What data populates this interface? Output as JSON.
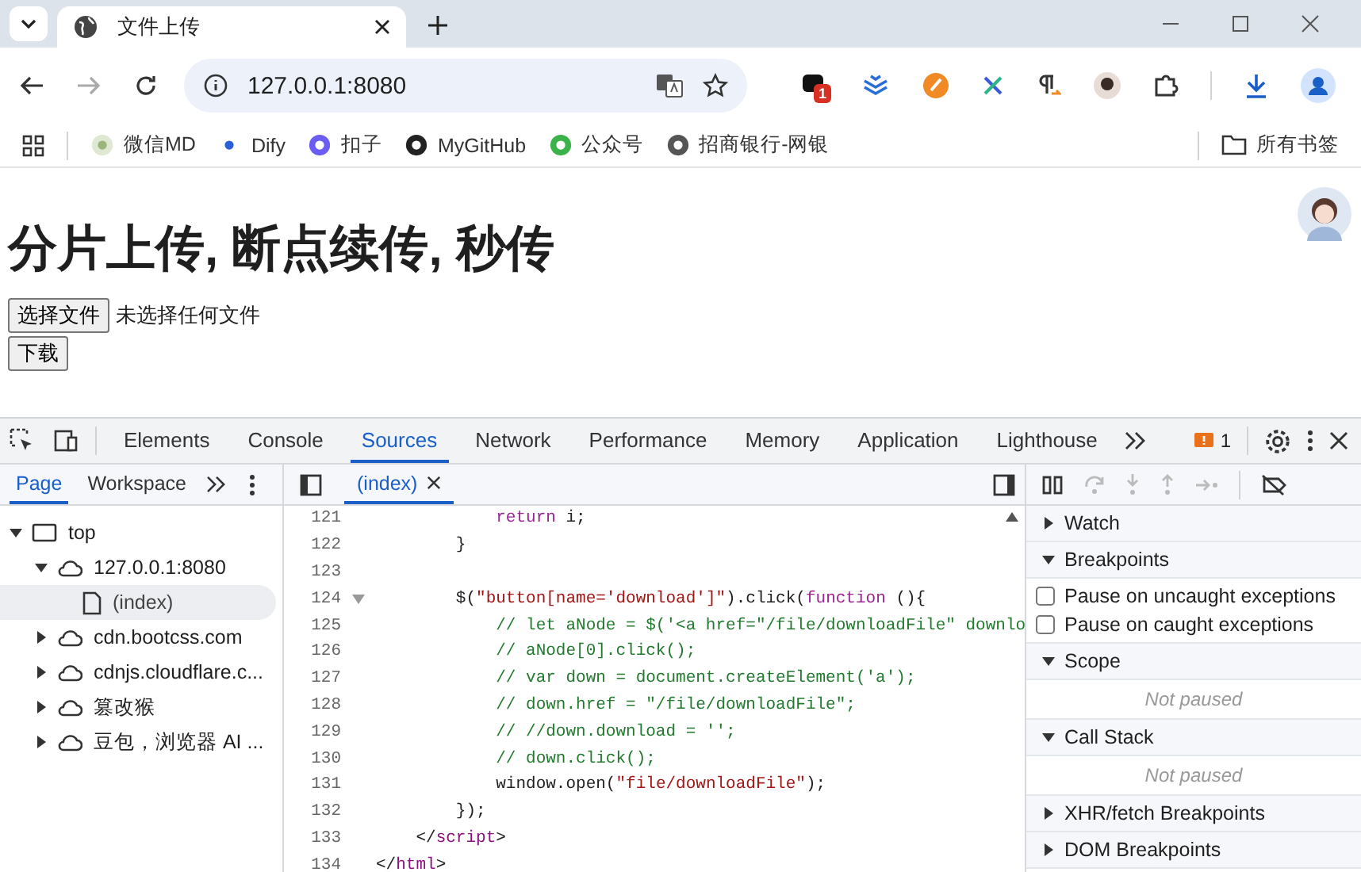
{
  "browser": {
    "tabs": [
      {
        "title": "文件上传",
        "selected": true
      }
    ],
    "address": "127.0.0.1:8080",
    "extension_badge": "1",
    "bookmarks": [
      {
        "label": "微信MD"
      },
      {
        "label": "Dify"
      },
      {
        "label": "扣子"
      },
      {
        "label": "MyGitHub"
      },
      {
        "label": "公众号"
      },
      {
        "label": "招商银行-网银"
      }
    ],
    "all_bookmarks": "所有书签"
  },
  "page": {
    "heading": "分片上传, 断点续传, 秒传",
    "file_button": "选择文件",
    "file_status": "未选择任何文件",
    "download_button": "下载"
  },
  "devtools": {
    "tabs": [
      {
        "label": "Elements",
        "selected": false
      },
      {
        "label": "Console",
        "selected": false
      },
      {
        "label": "Sources",
        "selected": true
      },
      {
        "label": "Network",
        "selected": false
      },
      {
        "label": "Performance",
        "selected": false
      },
      {
        "label": "Memory",
        "selected": false
      },
      {
        "label": "Application",
        "selected": false
      },
      {
        "label": "Lighthouse",
        "selected": false
      }
    ],
    "issues_count": "1",
    "nav_tabs": [
      {
        "label": "Page",
        "selected": true
      },
      {
        "label": "Workspace",
        "selected": false
      }
    ],
    "editor_tab": "(index)",
    "tree": [
      {
        "label": "top",
        "kind": "frame",
        "expanded": true,
        "selected": false,
        "children": [
          {
            "label": "127.0.0.1:8080",
            "kind": "domain",
            "expanded": true,
            "selected": false,
            "children": [
              {
                "label": "(index)",
                "kind": "file",
                "selected": true
              }
            ]
          },
          {
            "label": "cdn.bootcss.com",
            "kind": "domain",
            "expanded": false,
            "selected": false
          },
          {
            "label": "cdnjs.cloudflare.c...",
            "kind": "domain",
            "expanded": false,
            "selected": false
          },
          {
            "label": "篡改猴",
            "kind": "domain",
            "expanded": false,
            "selected": false
          },
          {
            "label": "豆包，浏览器 AI ...",
            "kind": "domain",
            "expanded": false,
            "selected": false
          }
        ]
      }
    ],
    "code": [
      {
        "number": "121",
        "foldable": false,
        "tokens": [
          {
            "kind": "keyword",
            "text": "            return"
          },
          {
            "kind": "plain",
            "text": " i;"
          }
        ]
      },
      {
        "number": "122",
        "foldable": false,
        "tokens": [
          {
            "kind": "plain",
            "text": "        }"
          }
        ]
      },
      {
        "number": "123",
        "foldable": false
      },
      {
        "number": "124",
        "foldable": true,
        "tokens": [
          {
            "kind": "plain",
            "text": "        $("
          },
          {
            "kind": "string",
            "text": "\"button[name='download']\""
          },
          {
            "kind": "plain",
            "text": ").click("
          },
          {
            "kind": "keyword",
            "text": "function"
          },
          {
            "kind": "plain",
            "text": " (){"
          }
        ]
      },
      {
        "number": "125",
        "foldable": false,
        "tokens": [
          {
            "kind": "comment",
            "text": "            // let aNode = $('<a href=\"/file/downloadFile\" downlo"
          }
        ]
      },
      {
        "number": "126",
        "foldable": false,
        "tokens": [
          {
            "kind": "comment",
            "text": "            // aNode[0].click();"
          }
        ]
      },
      {
        "number": "127",
        "foldable": false,
        "tokens": [
          {
            "kind": "comment",
            "text": "            // var down = document.createElement('a');"
          }
        ]
      },
      {
        "number": "128",
        "foldable": false,
        "tokens": [
          {
            "kind": "comment",
            "text": "            // down.href = \"/file/downloadFile\";"
          }
        ]
      },
      {
        "number": "129",
        "foldable": false,
        "tokens": [
          {
            "kind": "comment",
            "text": "            // //down.download = '';"
          }
        ]
      },
      {
        "number": "130",
        "foldable": false,
        "tokens": [
          {
            "kind": "comment",
            "text": "            // down.click();"
          }
        ]
      },
      {
        "number": "131",
        "foldable": false,
        "tokens": [
          {
            "kind": "plain",
            "text": "            window.open("
          },
          {
            "kind": "string",
            "text": "\"file/downloadFile\""
          },
          {
            "kind": "plain",
            "text": ");"
          }
        ]
      },
      {
        "number": "132",
        "foldable": false,
        "tokens": [
          {
            "kind": "plain",
            "text": "        });"
          }
        ]
      },
      {
        "number": "133",
        "foldable": false,
        "tokens": [
          {
            "kind": "plain",
            "text": "    </"
          },
          {
            "kind": "tag",
            "text": "script"
          },
          {
            "kind": "plain",
            "text": ">"
          }
        ]
      },
      {
        "number": "134",
        "foldable": false,
        "tokens": [
          {
            "kind": "plain",
            "text": "</"
          },
          {
            "kind": "tag",
            "text": "html"
          },
          {
            "kind": "plain",
            "text": ">"
          }
        ]
      }
    ],
    "sections": [
      {
        "title": "Watch",
        "expanded": false
      },
      {
        "title": "Breakpoints",
        "expanded": true,
        "checkboxes": [
          {
            "label": "Pause on uncaught exceptions",
            "checked": false
          },
          {
            "label": "Pause on caught exceptions",
            "checked": false
          }
        ]
      },
      {
        "title": "Scope",
        "expanded": true,
        "message": "Not paused"
      },
      {
        "title": "Call Stack",
        "expanded": true,
        "message": "Not paused"
      },
      {
        "title": "XHR/fetch Breakpoints",
        "expanded": false
      },
      {
        "title": "DOM Breakpoints",
        "expanded": false
      }
    ]
  }
}
